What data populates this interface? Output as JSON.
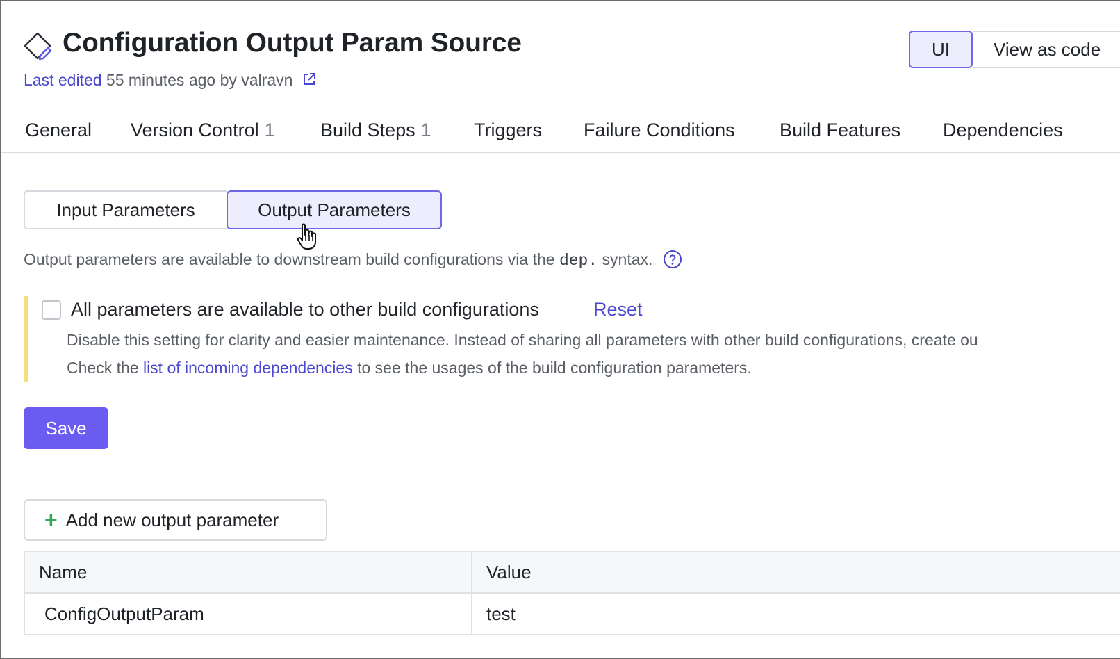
{
  "header": {
    "title": "Configuration Output Param Source",
    "icon": "build-config-edit-icon",
    "last_edited_label": "Last edited",
    "last_edited_rest": "55 minutes ago by valravn",
    "external_link_icon": "external-link-icon"
  },
  "view_toggle": {
    "ui_label": "UI",
    "code_label": "View as code",
    "selected": "UI"
  },
  "tabs": [
    {
      "label": "General",
      "count": ""
    },
    {
      "label": "Version Control",
      "count": "1"
    },
    {
      "label": "Build Steps",
      "count": "1"
    },
    {
      "label": "Triggers",
      "count": ""
    },
    {
      "label": "Failure Conditions",
      "count": ""
    },
    {
      "label": "Build Features",
      "count": ""
    },
    {
      "label": "Dependencies",
      "count": ""
    }
  ],
  "param_tabs": {
    "input_label": "Input Parameters",
    "output_label": "Output Parameters",
    "selected": "Output Parameters"
  },
  "description": {
    "before": "Output parameters are available to downstream build configurations via the",
    "code": "dep.",
    "after": "syntax.",
    "help_icon": "question-circle-icon"
  },
  "callout": {
    "checkbox_checked": false,
    "checkbox_label": "All parameters are available to other build configurations",
    "reset_label": "Reset",
    "hint_line1": "Disable this setting for clarity and easier maintenance. Instead of sharing all parameters with other build configurations, create ou",
    "hint_line2_before": "Check the",
    "hint_line2_link": "list of incoming dependencies",
    "hint_line2_after": "to see the usages of the build configuration parameters."
  },
  "save_label": "Save",
  "add_button_label": "Add new output parameter",
  "table": {
    "columns": [
      "Name",
      "Value"
    ],
    "rows": [
      {
        "name": "ConfigOutputParam",
        "value": "test"
      }
    ]
  },
  "colors": {
    "accent": "#6a5cf1",
    "link": "#4a47d1",
    "callout_bar": "#f6df7e",
    "plus": "#2fa84f"
  }
}
